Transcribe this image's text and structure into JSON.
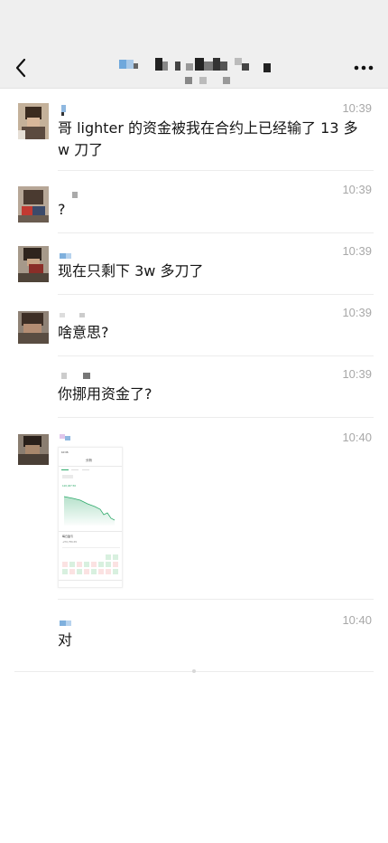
{
  "header": {
    "back_icon": "chevron-left-icon",
    "more_icon": "more-dots-icon"
  },
  "messages": [
    {
      "time": "10:39",
      "text": "哥 lighter 的资金被我在合约上已经输了 13 多 w 刀了"
    },
    {
      "time": "10:39",
      "text": "?"
    },
    {
      "time": "10:39",
      "text": "现在只剩下 3w 多刀了"
    },
    {
      "time": "10:39",
      "text": "啥意思?"
    },
    {
      "time": "10:39",
      "text": "你挪用资金了?"
    },
    {
      "time": "10:40",
      "type": "image"
    },
    {
      "time": "10:40",
      "text": "对"
    }
  ],
  "screenshot_thumb": {
    "status_time": "10:36",
    "title": "分析",
    "value": "120,467.56",
    "section": "每日盈亏",
    "amount": "-270,756.65",
    "accent": "#2eaa6b"
  }
}
